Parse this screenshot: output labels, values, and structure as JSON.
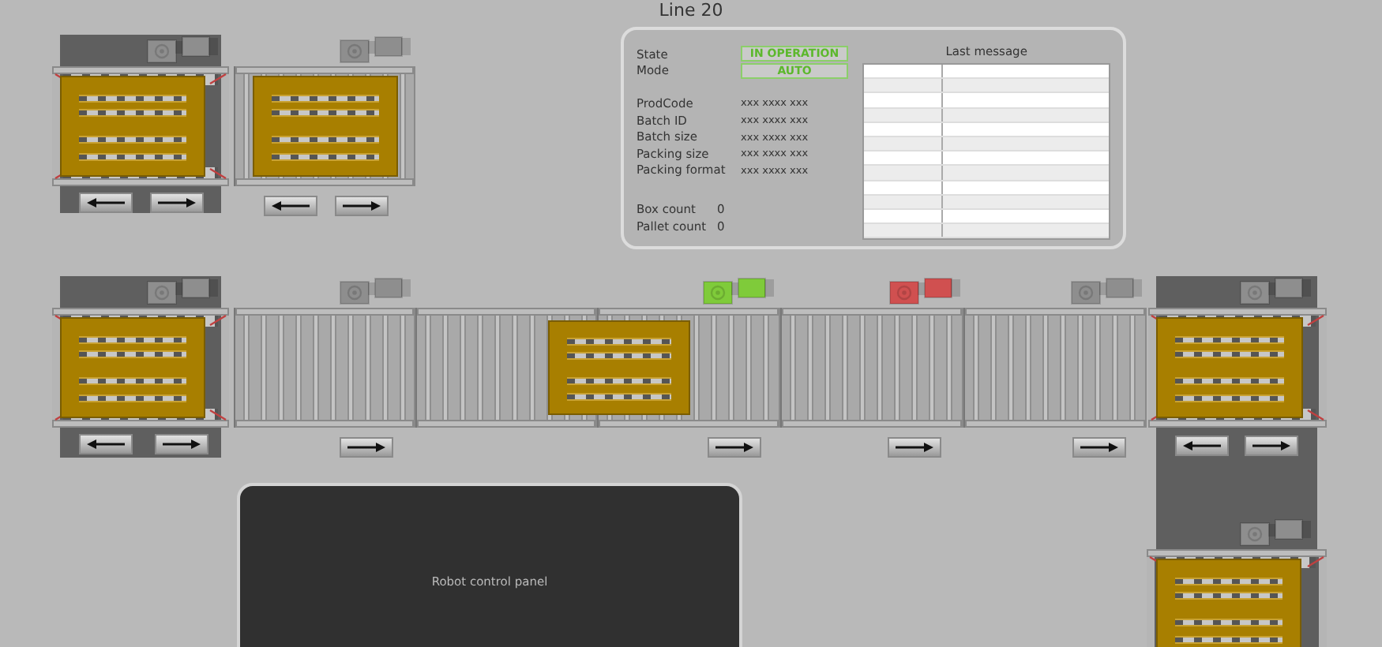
{
  "title": "Line 20",
  "info_panel": {
    "fields": [
      {
        "label": "State",
        "value": "IN OPERATION",
        "kind": "badge"
      },
      {
        "label": "Mode",
        "value": "AUTO",
        "kind": "badge"
      },
      {
        "label": "ProdCode",
        "value": "xxx xxxx xxx",
        "kind": "text"
      },
      {
        "label": "Batch ID",
        "value": "xxx xxxx xxx",
        "kind": "text"
      },
      {
        "label": "Batch size",
        "value": "xxx xxxx xxx",
        "kind": "text"
      },
      {
        "label": "Packing size",
        "value": "xxx xxxx xxx",
        "kind": "text"
      },
      {
        "label": "Packing format",
        "value": "xxx xxxx xxx",
        "kind": "text"
      },
      {
        "label": "Box count",
        "value": "0",
        "kind": "count"
      },
      {
        "label": "Pallet count",
        "value": "0",
        "kind": "count"
      }
    ],
    "message_log": {
      "title": "Last message"
    }
  },
  "conveyors": [
    {
      "kind": "turntable",
      "pallet": true,
      "motor": {
        "color": "#8e8e8e"
      },
      "buttons": [
        {
          "kind": "left"
        },
        {
          "kind": "right"
        }
      ]
    },
    {
      "kind": "roller",
      "pallet": true,
      "motor": {
        "color": "#8e8e8e"
      },
      "buttons": [
        {
          "kind": "left"
        },
        {
          "kind": "right"
        }
      ]
    },
    {
      "kind": "turntable",
      "pallet": true,
      "motor": {
        "color": "#8e8e8e"
      },
      "buttons": [
        {
          "kind": "left"
        },
        {
          "kind": "right"
        }
      ]
    },
    {
      "kind": "roller",
      "pallet": false,
      "motor": {
        "color": "#8e8e8e"
      },
      "buttons": [
        {
          "kind": "right"
        }
      ]
    },
    {
      "kind": "roller",
      "pallet": true
    },
    {
      "kind": "roller",
      "pallet": false,
      "motor": {
        "color": "#7fcb3a"
      },
      "buttons": [
        {
          "kind": "right"
        }
      ]
    },
    {
      "kind": "roller",
      "pallet": false,
      "motor": {
        "color": "#d05050"
      },
      "buttons": [
        {
          "kind": "right"
        }
      ]
    },
    {
      "kind": "roller",
      "pallet": false,
      "motor": {
        "color": "#8e8e8e"
      },
      "buttons": [
        {
          "kind": "right"
        }
      ]
    },
    {
      "kind": "turntable",
      "pallet": true,
      "motor": {
        "color": "#8e8e8e"
      },
      "buttons": [
        {
          "kind": "left"
        },
        {
          "kind": "right"
        }
      ]
    },
    {
      "kind": "turntable",
      "pallet": true,
      "motor": {
        "color": "#8e8e8e"
      }
    }
  ],
  "robot_panel": {
    "label": "Robot control panel"
  }
}
